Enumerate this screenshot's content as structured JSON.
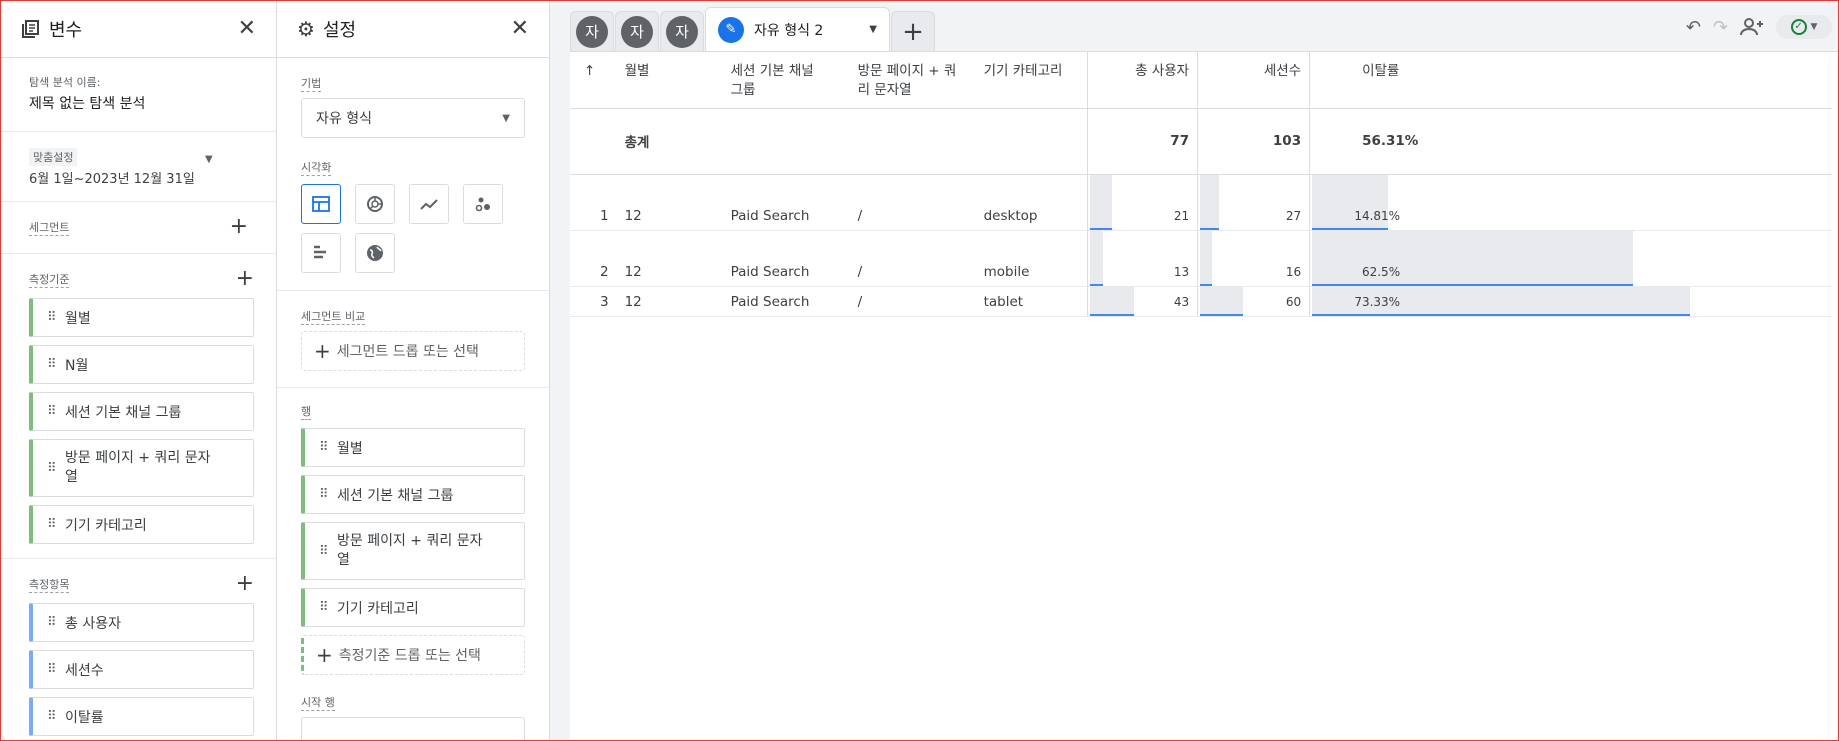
{
  "variables": {
    "title": "변수",
    "exploration_name_label": "탐색 분석 이름:",
    "exploration_name": "제목 없는 탐색 분석",
    "date_badge": "맞춤설정",
    "date_range": "6월 1일~2023년 12월 31일",
    "segments_label": "세그먼트",
    "dimensions_label": "측정기준",
    "dimensions": [
      "월별",
      "N월",
      "세션 기본 채널 그룹",
      "방문 페이지 + 쿼리 문자열",
      "기기 카테고리"
    ],
    "metrics_label": "측정항목",
    "metrics": [
      "총 사용자",
      "세션수",
      "이탈률"
    ]
  },
  "settings": {
    "title": "설정",
    "technique_label": "기법",
    "technique_value": "자유 형식",
    "visualization_label": "시각화",
    "viz_icons": [
      "table-icon",
      "donut-chart-icon",
      "line-chart-icon",
      "scatter-icon",
      "bar-chart-icon",
      "geo-map-icon"
    ],
    "segment_compare_label": "세그먼트 비교",
    "segment_drop": "세그먼트 드롭 또는 선택",
    "rows_label": "행",
    "rows": [
      "월별",
      "세션 기본 채널 그룹",
      "방문 페이지 + 쿼리 문자열",
      "기기 카테고리"
    ],
    "rows_drop": "측정기준 드롭 또는 선택",
    "start_row_label": "시작 행"
  },
  "tabs": {
    "collapsed": [
      "자",
      "자",
      "자"
    ],
    "active": "자유 형식 2",
    "add": "+"
  },
  "table": {
    "sort_icon": "↑",
    "columns": [
      "월별",
      "세션 기본 채널 그룹",
      "방문 페이지 + 쿼리 문자열",
      "기기 카테고리"
    ],
    "metric_columns": [
      "총 사용자",
      "세션수",
      "이탈률"
    ],
    "total_label": "총계",
    "totals": [
      "77",
      "103",
      "56.31%"
    ],
    "rows": [
      {
        "n": "1",
        "month": "12",
        "channel": "Paid Search",
        "page": "/",
        "device": "desktop",
        "users": "21",
        "sessions": "27",
        "bounce": "14.81%",
        "users_frac": 0.49,
        "sessions_frac": 0.45,
        "bounce_frac": 0.2
      },
      {
        "n": "2",
        "month": "12",
        "channel": "Paid Search",
        "page": "/",
        "device": "mobile",
        "users": "13",
        "sessions": "16",
        "bounce": "62.5%",
        "users_frac": 0.3,
        "sessions_frac": 0.27,
        "bounce_frac": 0.85
      },
      {
        "n": "3",
        "month": "12",
        "channel": "Paid Search",
        "page": "/",
        "device": "tablet",
        "users": "43",
        "sessions": "60",
        "bounce": "73.33%",
        "users_frac": 1.0,
        "sessions_frac": 1.0,
        "bounce_frac": 1.0
      }
    ]
  },
  "colors": {
    "accent": "#1a73e8",
    "dimension_chip": "#7dbd7f",
    "metric_chip": "#7baaf7",
    "bar_line": "#4285f4"
  }
}
